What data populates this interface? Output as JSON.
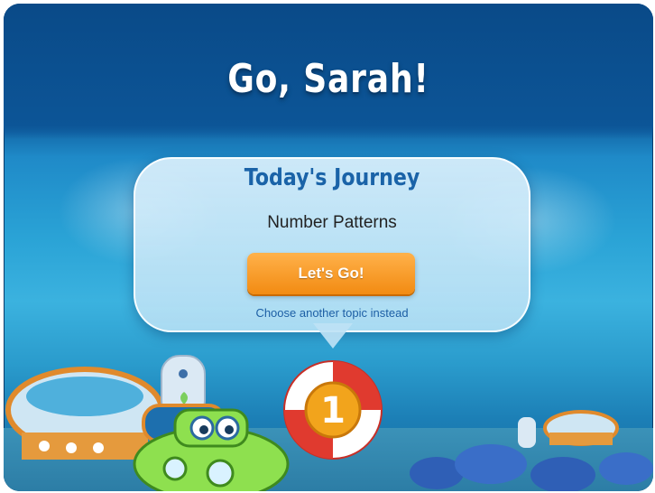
{
  "header": {
    "title": "Go, Sarah!"
  },
  "journey": {
    "heading": "Today's Journey",
    "topic": "Number Patterns",
    "go_label": "Let's Go!",
    "other_link": "Choose another topic instead"
  },
  "progress": {
    "step": "1"
  },
  "colors": {
    "header_blue": "#0c5394",
    "ocean": "#2aa3d6",
    "button_orange": "#f28b12",
    "link_blue": "#1d5fa5",
    "ring_red": "#e03a2f",
    "coin_gold": "#f2a41c"
  },
  "icons": [
    "life-ring-icon",
    "submarine-icon",
    "dome-base-icon"
  ]
}
